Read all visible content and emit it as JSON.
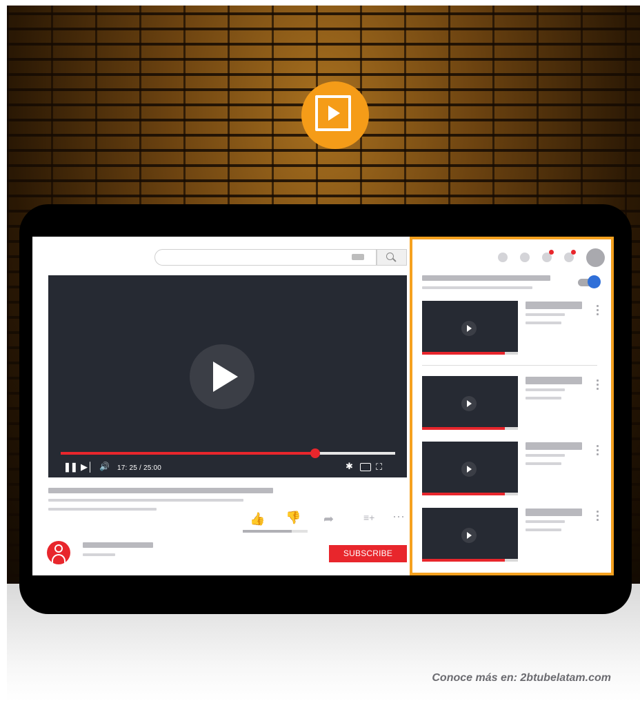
{
  "colors": {
    "accent_orange": "#f59c18",
    "youtube_red": "#e8262c",
    "toggle_blue": "#2f6fd8",
    "player_bg": "#262a33"
  },
  "logo": {
    "icon": "play-square-icon"
  },
  "player": {
    "time": "17: 25 / 25:00",
    "progress_fraction": 0.76,
    "icons": [
      "pause-icon",
      "skip-next-icon",
      "volume-icon",
      "settings-icon",
      "theater-icon",
      "fullscreen-icon"
    ]
  },
  "actions": {
    "icons": [
      "thumbs-up-icon",
      "thumbs-down-icon",
      "share-icon",
      "add-to-queue-icon",
      "more-icon"
    ],
    "like_ratio": 0.75
  },
  "channel": {
    "subscribe_label": "SUBSCRIBE"
  },
  "sidebar": {
    "autoplay_on": true,
    "items": [
      {
        "progress_fraction": 0.86
      },
      {
        "progress_fraction": 0.86
      },
      {
        "progress_fraction": 0.86
      },
      {
        "progress_fraction": 0.86
      }
    ]
  },
  "footer": {
    "text": "Conoce más en: 2btubelatam.com"
  }
}
